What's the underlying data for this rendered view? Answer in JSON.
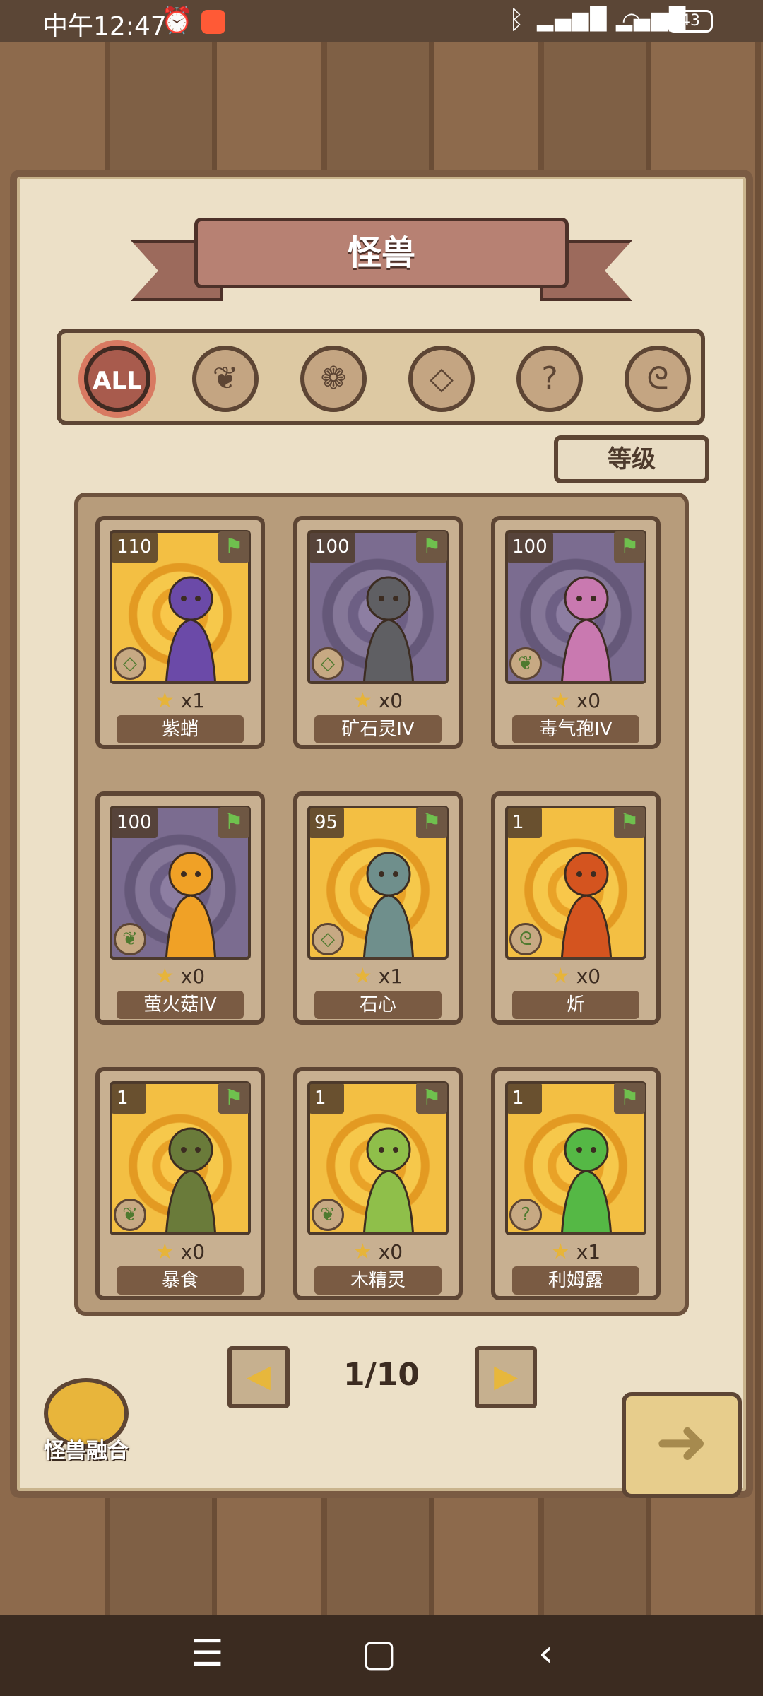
{
  "status_bar": {
    "time": "中午12:47",
    "battery": "43"
  },
  "title": "怪兽",
  "filters": [
    {
      "label": "ALL",
      "icon": "all-icon",
      "active": true
    },
    {
      "label": "",
      "icon": "leaf-icon"
    },
    {
      "label": "",
      "icon": "paw-icon"
    },
    {
      "label": "",
      "icon": "crystal-icon"
    },
    {
      "label": "",
      "icon": "question-icon"
    },
    {
      "label": "",
      "icon": "rune-icon"
    }
  ],
  "sort_label": "等级",
  "cards": [
    {
      "level": "110",
      "count": "x1",
      "name": "紫蛸",
      "bg": "yellow",
      "type_icon": "crystal-icon",
      "color": "#6b4aa8"
    },
    {
      "level": "100",
      "count": "x0",
      "name": "矿石灵IV",
      "bg": "purple",
      "type_icon": "crystal-icon",
      "color": "#5f5f63"
    },
    {
      "level": "100",
      "count": "x0",
      "name": "毒气孢IV",
      "bg": "purple",
      "type_icon": "leaf-icon",
      "color": "#c979b0"
    },
    {
      "level": "100",
      "count": "x0",
      "name": "萤火菇IV",
      "bg": "purple",
      "type_icon": "leaf-icon",
      "color": "#f0a126"
    },
    {
      "level": "95",
      "count": "x1",
      "name": "石心",
      "bg": "yellow",
      "type_icon": "crystal-icon",
      "color": "#6f8f8c"
    },
    {
      "level": "1",
      "count": "x0",
      "name": "炘",
      "bg": "yellow",
      "type_icon": "rune-icon",
      "color": "#d4541f"
    },
    {
      "level": "1",
      "count": "x0",
      "name": "暴食",
      "bg": "yellow",
      "type_icon": "leaf-icon",
      "color": "#6a7b3a"
    },
    {
      "level": "1",
      "count": "x0",
      "name": "木精灵",
      "bg": "yellow",
      "type_icon": "leaf-icon",
      "color": "#8fbf4a"
    },
    {
      "level": "1",
      "count": "x1",
      "name": "利姆露",
      "bg": "yellow",
      "type_icon": "question-icon",
      "color": "#55b845"
    }
  ],
  "pagination": {
    "text": "1/10"
  },
  "fusion_label": "怪兽融合"
}
